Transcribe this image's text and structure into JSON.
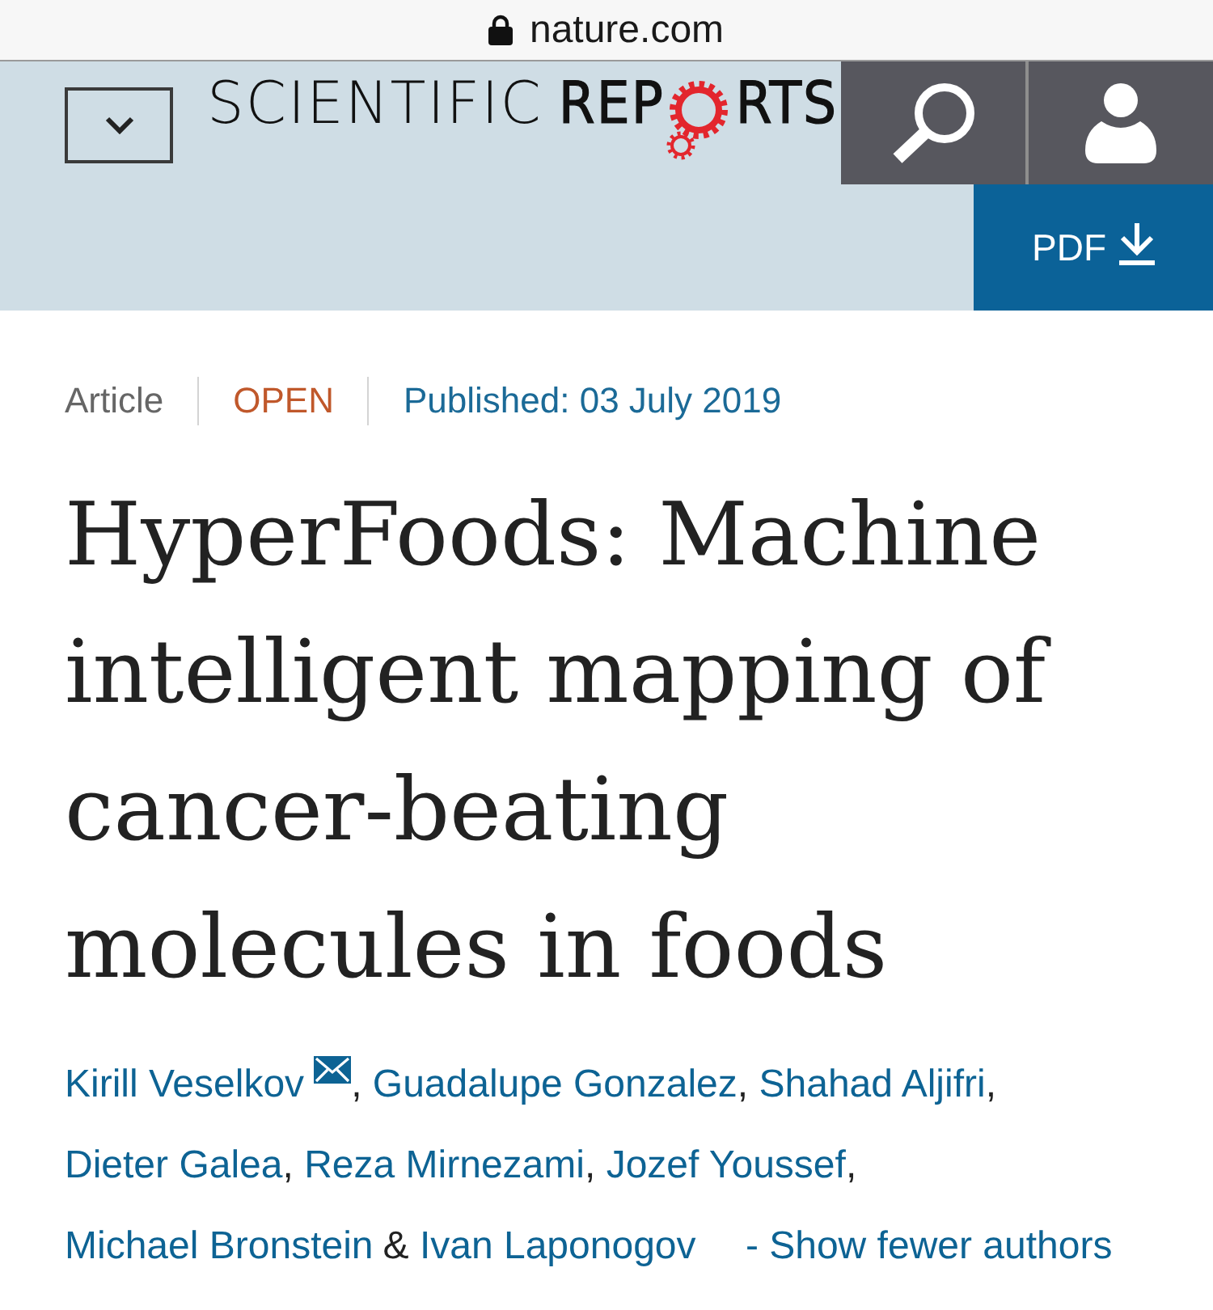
{
  "browser_bar": {
    "address": "nature.com",
    "secure": true
  },
  "header": {
    "logo": {
      "light": "SCIENTIFIC",
      "bold_start": "REP",
      "bold_end": "RTS"
    },
    "pdf_button": "PDF"
  },
  "article": {
    "type": "Article",
    "access": "OPEN",
    "published": "Published: 03 July 2019",
    "title": "HyperFoods: Machine intelligent mapping of cancer-beating molecules in foods",
    "authors": [
      {
        "name": "Kirill Veselkov",
        "corresponding": true,
        "separator": ","
      },
      {
        "name": "Guadalupe Gonzalez",
        "corresponding": false,
        "separator": ","
      },
      {
        "name": "Shahad Aljifri",
        "corresponding": false,
        "separator": ","
      },
      {
        "name": "Dieter Galea",
        "corresponding": false,
        "separator": ","
      },
      {
        "name": "Reza Mirnezami",
        "corresponding": false,
        "separator": ","
      },
      {
        "name": "Jozef Youssef",
        "corresponding": false,
        "separator": ","
      },
      {
        "name": "Michael Bronstein",
        "corresponding": false,
        "conjunction": "&"
      },
      {
        "name": "Ivan Laponogov",
        "corresponding": false
      }
    ],
    "authors_toggle": "- Show fewer authors"
  }
}
